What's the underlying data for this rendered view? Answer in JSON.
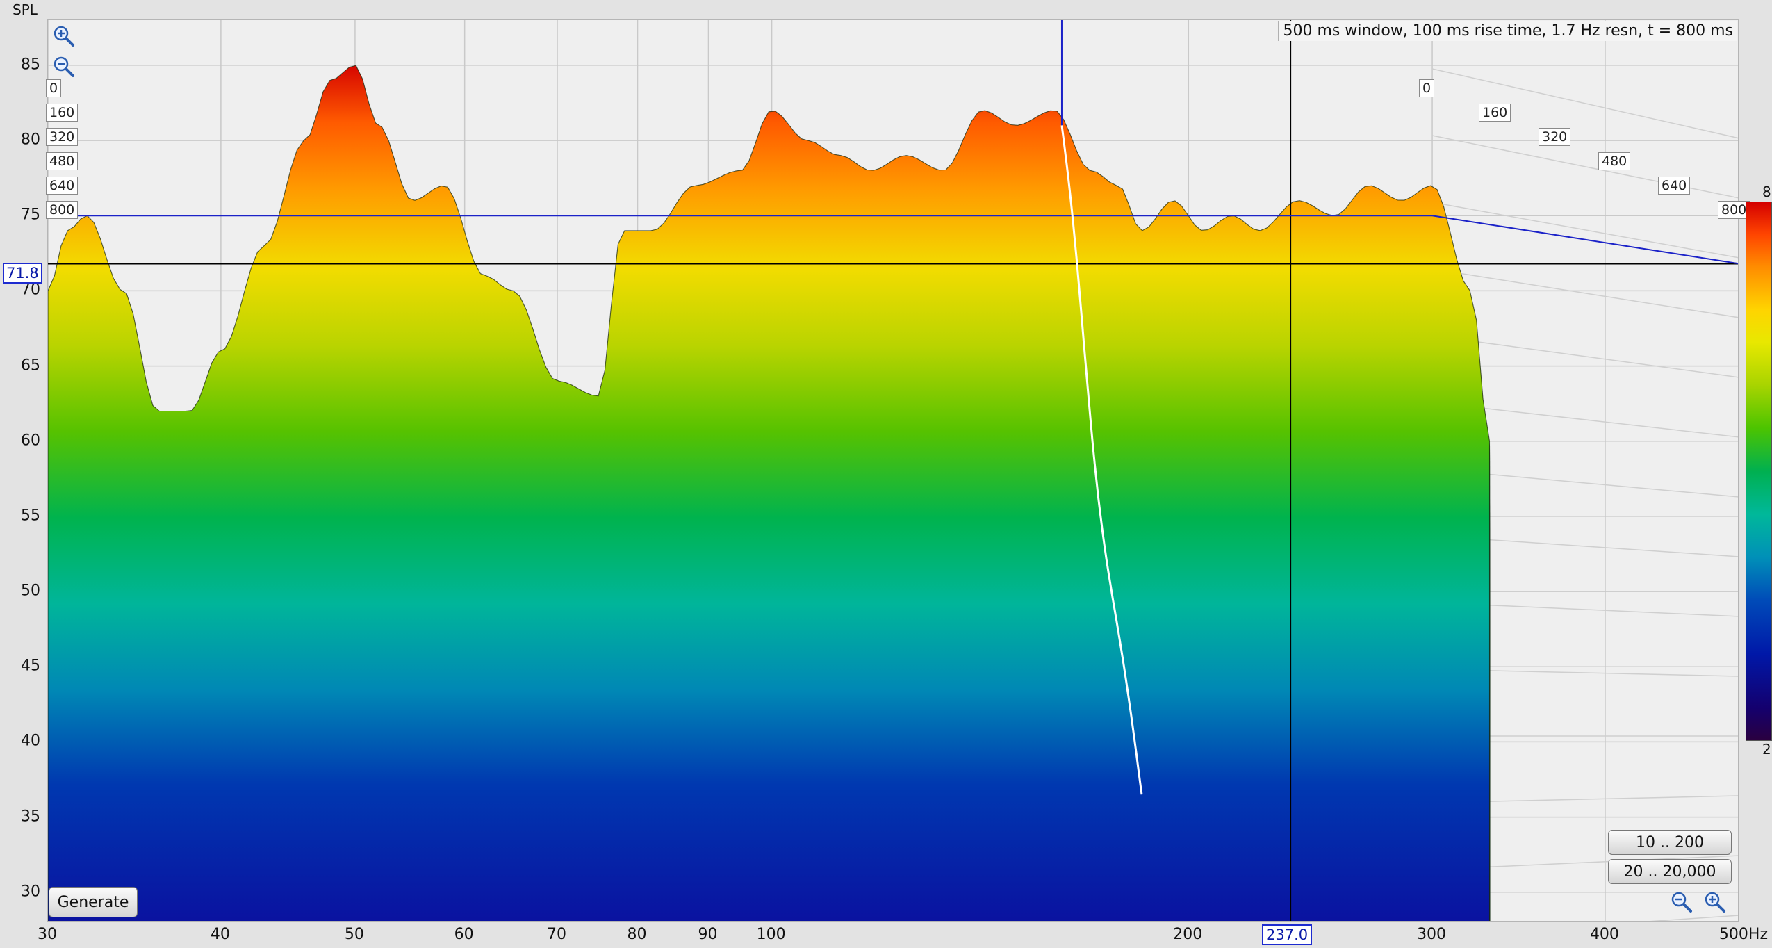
{
  "chart_data": {
    "type": "area",
    "title": "",
    "info": "500 ms window, 100 ms rise time,  1.7 Hz resn, t = 800 ms",
    "ylabel": "SPL",
    "xunit": "Hz",
    "xscale": "log",
    "xlim": [
      30,
      500
    ],
    "ylim": [
      28,
      88
    ],
    "yticks": [
      30,
      35,
      40,
      45,
      50,
      55,
      60,
      65,
      70,
      75,
      80,
      85
    ],
    "xticks": [
      {
        "v": 30,
        "label": "30"
      },
      {
        "v": 40,
        "label": "40"
      },
      {
        "v": 50,
        "label": "50"
      },
      {
        "v": 60,
        "label": "60"
      },
      {
        "v": 70,
        "label": "70"
      },
      {
        "v": 80,
        "label": "80"
      },
      {
        "v": 90,
        "label": "90"
      },
      {
        "v": 100,
        "label": "100"
      },
      {
        "v": 200,
        "label": "200"
      },
      {
        "v": 300,
        "label": "300"
      },
      {
        "v": 400,
        "label": "400"
      },
      {
        "v": 500,
        "label": "500"
      }
    ],
    "time_labels": [
      "0",
      "160",
      "320",
      "480",
      "640",
      "800"
    ],
    "front_spectrum": {
      "x": [
        30,
        31,
        32,
        34,
        36,
        38,
        40,
        43,
        46,
        48,
        50,
        52,
        55,
        58,
        62,
        65,
        70,
        75,
        78,
        82,
        88,
        95,
        100,
        106,
        112,
        118,
        125,
        133,
        142,
        150,
        160,
        170,
        178,
        185,
        195,
        205,
        215,
        225,
        240,
        255,
        270,
        285,
        300,
        320,
        330
      ],
      "y": [
        70,
        74,
        75,
        70,
        62,
        62,
        66,
        73,
        80,
        84,
        85,
        81,
        76,
        77,
        71,
        70,
        64,
        63,
        74,
        74,
        77,
        78,
        82,
        80,
        79,
        78,
        79,
        78,
        82,
        81,
        82,
        78,
        77,
        74,
        76,
        74,
        75,
        74,
        76,
        75,
        77,
        76,
        77,
        70,
        60
      ]
    },
    "waterfall_slices": 100,
    "cursor": {
      "x": 237.0,
      "y": 71.8,
      "x_label": "237.0",
      "y_label": "71.8"
    },
    "colorbar": {
      "top_label": "8",
      "bottom_label": "2"
    }
  },
  "controls": {
    "generate": "Generate",
    "range_low": "10 .. 200",
    "range_full": "20 .. 20,000"
  },
  "icons": {
    "zoom_in": "zoom-in-icon",
    "zoom_out": "zoom-out-icon"
  }
}
